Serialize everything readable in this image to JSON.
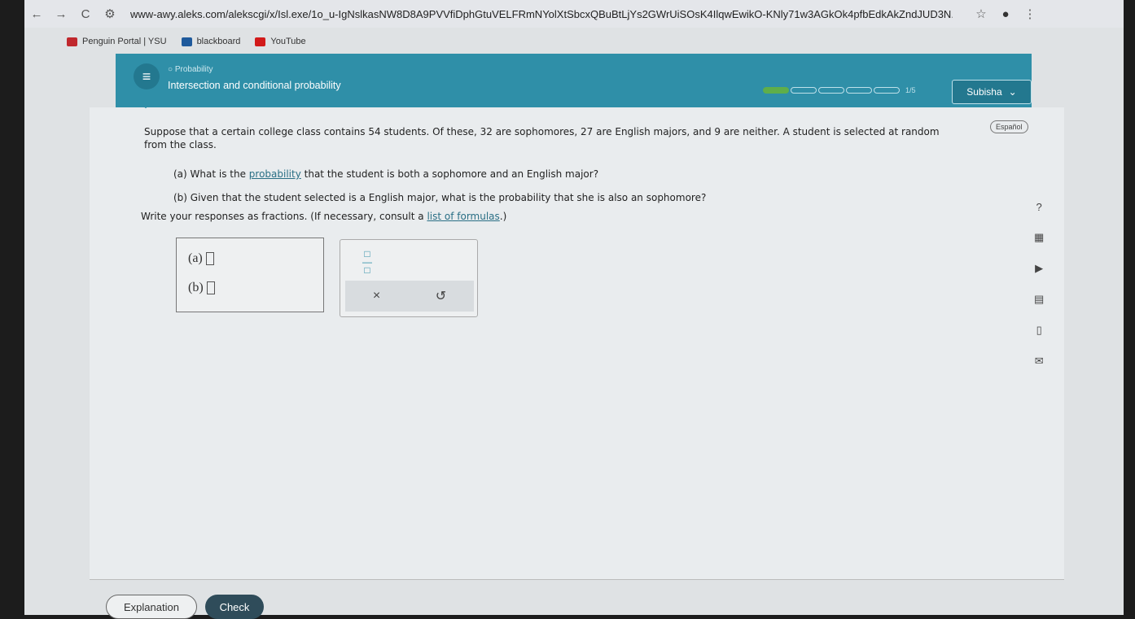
{
  "browser": {
    "url": "www-awy.aleks.com/alekscgi/x/Isl.exe/1o_u-IgNslkasNW8D8A9PVVfiDphGtuVELFRmNYolXtSbcxQBuBtLjYs2GWrUiSOsK4IlqwEwikO-KNly71w3AGkOk4pfbEdkAkZndJUD3N...",
    "back": "←",
    "forward": "→",
    "reload": "C",
    "star": "☆",
    "menu": "⋮",
    "bookmarks": [
      {
        "label": "Penguin Portal | YSU",
        "color": "#c0282d"
      },
      {
        "label": "blackboard",
        "color": "#1f5a9c"
      },
      {
        "label": "YouTube",
        "color": "#d21a1a"
      }
    ]
  },
  "header": {
    "topic": "Probability",
    "title": "Intersection and conditional probability",
    "progress": {
      "current": 1,
      "total": 5,
      "label": "1/5"
    },
    "user": "Subisha",
    "accent": "#2f8fa8"
  },
  "content": {
    "espanol": "Español",
    "problem": "Suppose that a certain college class contains 54 students. Of these, 32 are sophomores, 27 are English majors, and 9 are neither. A student is selected at random from the class.",
    "part_a_pre": "(a) What is the ",
    "part_a_link": "probability",
    "part_a_post": " that the student is both a sophomore and an English major?",
    "part_b": "(b) Given that the student selected is a English major, what is the probability that she is also an sophomore?",
    "instr_pre": "Write your responses as fractions. (If necessary, consult a ",
    "instr_link": "list of formulas",
    "instr_post": ".)",
    "answers": [
      {
        "label": "(a)",
        "value": ""
      },
      {
        "label": "(b)",
        "value": ""
      }
    ],
    "tools": {
      "clear": "×",
      "undo": "↺"
    }
  },
  "footer": {
    "explanation": "Explanation",
    "check": "Check"
  }
}
